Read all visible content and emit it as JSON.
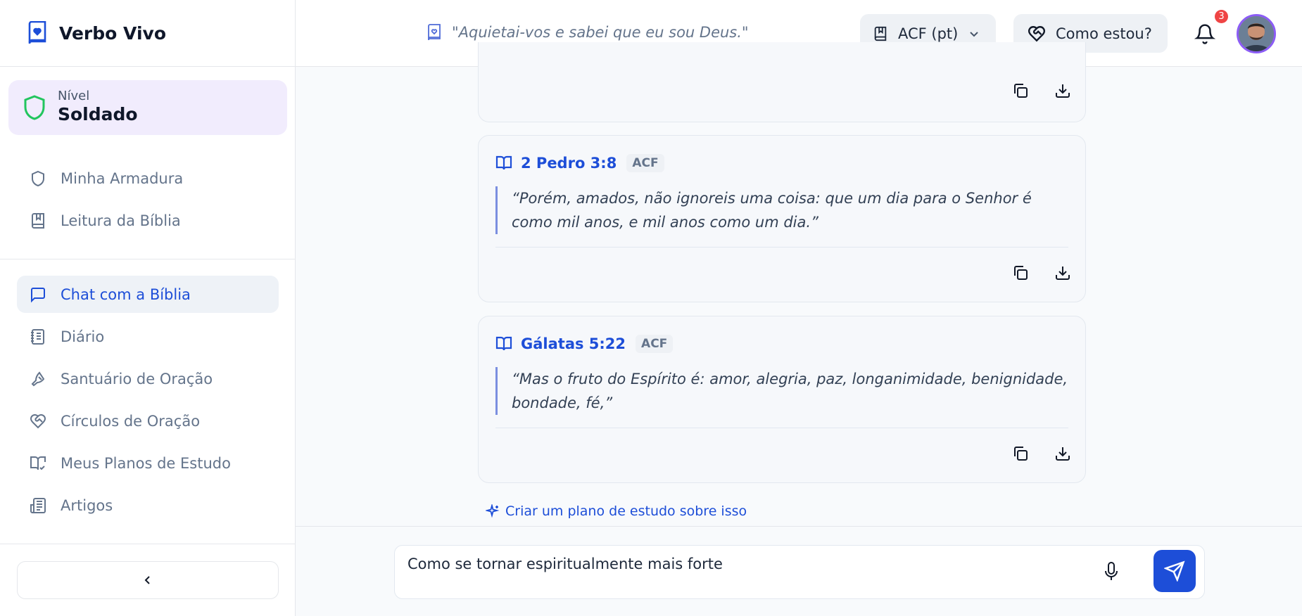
{
  "app": {
    "name": "Verbo Vivo"
  },
  "level": {
    "label": "Nível",
    "value": "Soldado"
  },
  "sidebar": {
    "group1": [
      {
        "label": "Minha Armadura",
        "icon": "shield-icon"
      },
      {
        "label": "Leitura da Bíblia",
        "icon": "book-bookmark-icon"
      }
    ],
    "group2": [
      {
        "label": "Chat com a Bíblia",
        "icon": "message-square-icon",
        "active": true
      },
      {
        "label": "Diário",
        "icon": "notebook-icon"
      },
      {
        "label": "Santuário de Oração",
        "icon": "praying-hands-icon"
      },
      {
        "label": "Círculos de Oração",
        "icon": "heart-handshake-icon"
      },
      {
        "label": "Meus Planos de Estudo",
        "icon": "book-open-check-icon"
      },
      {
        "label": "Artigos",
        "icon": "newspaper-icon"
      }
    ]
  },
  "header": {
    "daily_verse": "\"Aquietai-vos e sabei que eu sou Deus.\"",
    "version": "ACF (pt)",
    "mood_button": "Como estou?",
    "notifications_count": "3"
  },
  "verses": [
    {
      "reference": "2 Pedro 3:8",
      "version": "ACF",
      "text": "“Porém, amados, não ignoreis uma coisa: que um dia para o Senhor é como mil anos, e mil anos como um dia.”"
    },
    {
      "reference": "Gálatas 5:22",
      "version": "ACF",
      "text": "“Mas o fruto do Espírito é: amor, alegria, paz, longanimidade, benignidade, bondade, fé,”"
    }
  ],
  "study_plan_link": "Criar um plano de estudo sobre isso",
  "chat_input": {
    "value": "Como se tornar espiritualmente mais forte"
  },
  "colors": {
    "accent": "#1d4ed8",
    "level_bg": "#f1ecfd",
    "shield_green": "#22c55e",
    "badge": "#ef4444"
  }
}
